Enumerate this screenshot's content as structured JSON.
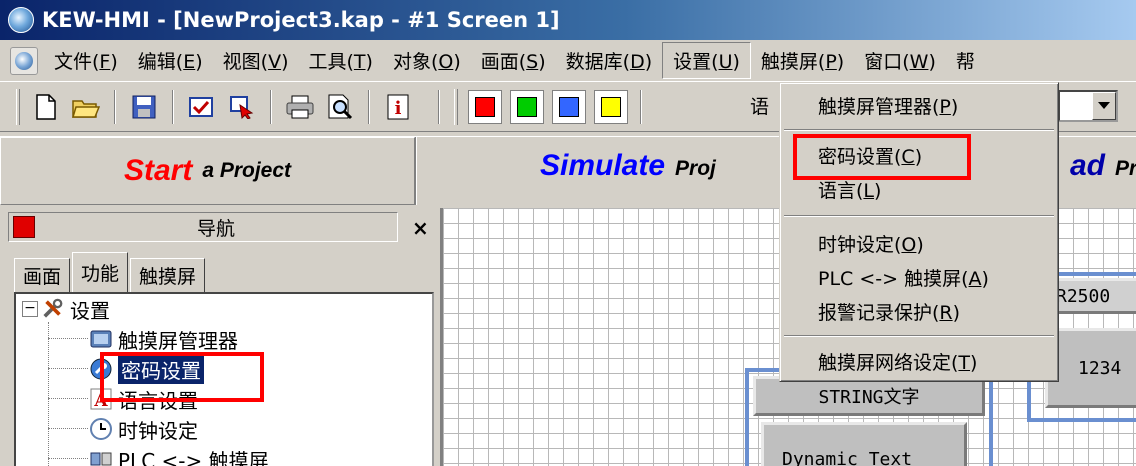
{
  "window": {
    "title": "KEW-HMI - [NewProject3.kap - #1 Screen 1]"
  },
  "menu": [
    {
      "label": "文件(F)"
    },
    {
      "label": "编辑(E)"
    },
    {
      "label": "视图(V)"
    },
    {
      "label": "工具(T)"
    },
    {
      "label": "对象(O)"
    },
    {
      "label": "画面(S)"
    },
    {
      "label": "数据库(D)"
    },
    {
      "label": "设置(U)",
      "active": true
    },
    {
      "label": "触摸屏(P)"
    },
    {
      "label": "窗口(W)"
    },
    {
      "label": "帮"
    }
  ],
  "toolbar": {
    "icons": [
      "new-file-icon",
      "open-folder-icon",
      "save-icon",
      "check-icon",
      "import-icon",
      "print-icon",
      "print-preview-icon",
      "info-icon"
    ],
    "swatches": [
      "#ff0000",
      "#00cc00",
      "#3366ff",
      "#ffff00"
    ],
    "language_label": "语"
  },
  "wizard": {
    "start_big": "Start",
    "start_small": "a Project",
    "simulate_big": "Simulate",
    "simulate_small": "Proj",
    "download_big": "ad",
    "download_small": "Pr"
  },
  "nav": {
    "title": "导航",
    "close": "×",
    "tabs": [
      {
        "label": "画面"
      },
      {
        "label": "功能",
        "active": true
      },
      {
        "label": "触摸屏"
      }
    ],
    "tree": [
      {
        "label": "设置",
        "icon": "tools-icon",
        "expander": "−"
      },
      {
        "label": "触摸屏管理器",
        "icon": "touchscreen-manager-icon"
      },
      {
        "label": "密码设置",
        "icon": "password-icon",
        "selected": true
      },
      {
        "label": "语言设置",
        "icon": "language-icon"
      },
      {
        "label": "时钟设定",
        "icon": "clock-icon"
      },
      {
        "label": "PLC <-> 触摸屏",
        "icon": "plc-link-icon"
      }
    ]
  },
  "canvas": {
    "widget_string": "STRING文字",
    "widget_dynamic": "Dynamic Text",
    "widget_r2500": "R2500",
    "widget_1234": "1234"
  },
  "dropdown": [
    {
      "label": "触摸屏管理器(P)"
    },
    {
      "label": "密码设置(C)",
      "highlighted": true
    },
    {
      "label": "语言(L)"
    },
    {
      "label": "时钟设定(O)"
    },
    {
      "label": "PLC <-> 触摸屏(A)"
    },
    {
      "label": "报警记录保护(R)"
    },
    {
      "label": "触摸屏网络设定(T)"
    }
  ],
  "colors": {
    "highlight_box": "#ff0000",
    "title_gradient_start": "#0a246a",
    "selection": "#0a246a"
  }
}
